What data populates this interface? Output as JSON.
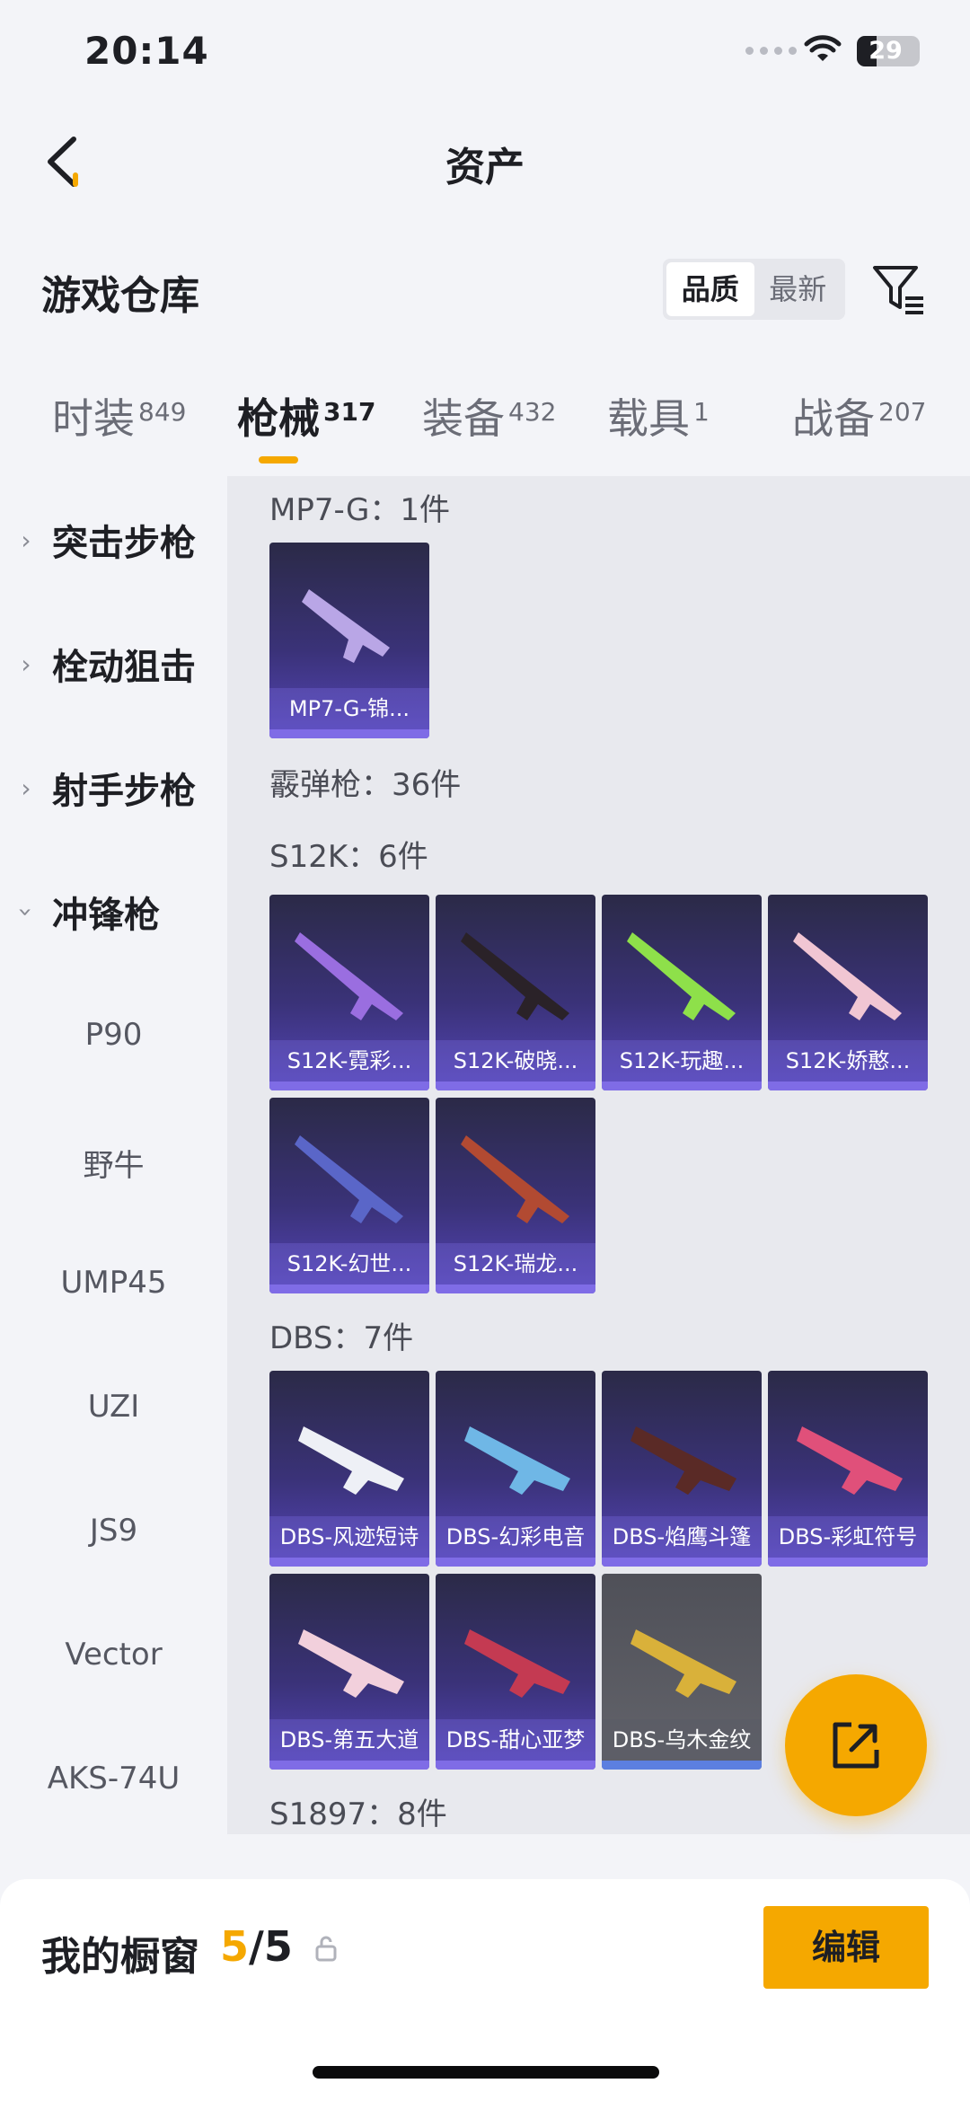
{
  "status": {
    "time": "20:14",
    "battery": "29"
  },
  "header": {
    "title": "资产"
  },
  "warehouse": {
    "title": "游戏仓库",
    "sort": [
      "品质",
      "最新"
    ]
  },
  "tabs": [
    {
      "label": "时装",
      "count": "849"
    },
    {
      "label": "枪械",
      "count": "317"
    },
    {
      "label": "装备",
      "count": "432"
    },
    {
      "label": "载具",
      "count": "1"
    },
    {
      "label": "战备",
      "count": "207"
    }
  ],
  "sidebar": {
    "categories": [
      "突击步枪",
      "栓动狙击",
      "射手步枪",
      "冲锋枪"
    ],
    "subs": [
      "P90",
      "野牛",
      "UMP45",
      "UZI",
      "JS9",
      "Vector",
      "AKS-74U"
    ]
  },
  "content": {
    "mp7_header": "MP7-G：1件",
    "mp7_items": [
      "MP7-G-锦..."
    ],
    "shotgun_header": "霰弹枪：36件",
    "s12k_header": "S12K：6件",
    "s12k_items": [
      "S12K-霓彩...",
      "S12K-破晓...",
      "S12K-玩趣...",
      "S12K-娇憨...",
      "S12K-幻世...",
      "S12K-瑞龙..."
    ],
    "dbs_header": "DBS：7件",
    "dbs_items": [
      "DBS-风迹短诗",
      "DBS-幻彩电音",
      "DBS-焰鹰斗篷",
      "DBS-彩虹符号",
      "DBS-第五大道",
      "DBS-甜心亚梦",
      "DBS-乌木金纹"
    ],
    "s1897_header": "S1897：8件"
  },
  "showcase": {
    "title": "我的橱窗",
    "current": "5",
    "total": "/5",
    "edit_label": "编辑"
  },
  "colors": {
    "accent": "#f5a800",
    "card_purple": "#3a3278",
    "card_gray": "#63646b"
  }
}
